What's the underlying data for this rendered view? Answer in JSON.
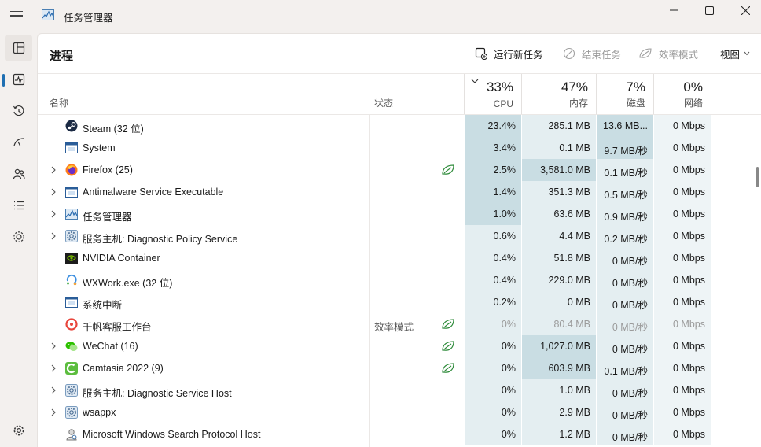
{
  "window": {
    "title": "任务管理器"
  },
  "sidebar": {
    "items": [
      {
        "name": "processes",
        "icon": "processes-icon",
        "active": true
      },
      {
        "name": "performance",
        "icon": "performance-icon"
      },
      {
        "name": "app-history",
        "icon": "history-icon"
      },
      {
        "name": "startup-apps",
        "icon": "startup-icon"
      },
      {
        "name": "users",
        "icon": "users-icon"
      },
      {
        "name": "details",
        "icon": "details-icon"
      },
      {
        "name": "services",
        "icon": "services-icon"
      }
    ],
    "settings_icon": "settings-icon"
  },
  "toolbar": {
    "page_title": "进程",
    "run_new_task": "运行新任务",
    "end_task": "结束任务",
    "efficiency_mode": "效率模式",
    "view": "视图"
  },
  "columns": {
    "name": "名称",
    "status": "状态",
    "cpu": {
      "pct": "33%",
      "label": "CPU"
    },
    "memory": {
      "pct": "47%",
      "label": "内存"
    },
    "disk": {
      "pct": "7%",
      "label": "磁盘"
    },
    "network": {
      "pct": "0%",
      "label": "网络"
    }
  },
  "colors": {
    "accent": "#1f6fb2",
    "heat_strong": "#c9dde3",
    "heat_light": "#e4eef1",
    "heat_faint": "#eef4f6",
    "efficiency_green": "#2e8b3a"
  },
  "processes": [
    {
      "name": "Steam (32 位)",
      "icon": "steam-icon",
      "expandable": false,
      "status": "",
      "leaf": false,
      "cpu": "23.4%",
      "mem": "285.1 MB",
      "disk": "13.6 MB...",
      "net": "0 Mbps",
      "heat": [
        "strong",
        "light",
        "strong",
        "faint"
      ]
    },
    {
      "name": "System",
      "icon": "system-icon",
      "expandable": false,
      "status": "",
      "leaf": false,
      "cpu": "3.4%",
      "mem": "0.1 MB",
      "disk": "9.7 MB/秒",
      "net": "0 Mbps",
      "heat": [
        "strong",
        "light",
        "strong",
        "faint"
      ]
    },
    {
      "name": "Firefox (25)",
      "icon": "firefox-icon",
      "expandable": true,
      "status": "",
      "leaf": true,
      "cpu": "2.5%",
      "mem": "3,581.0 MB",
      "disk": "0.1 MB/秒",
      "net": "0 Mbps",
      "heat": [
        "strong",
        "strong",
        "light",
        "faint"
      ]
    },
    {
      "name": "Antimalware Service Executable",
      "icon": "antimalware-icon",
      "expandable": true,
      "status": "",
      "leaf": false,
      "cpu": "1.4%",
      "mem": "351.3 MB",
      "disk": "0.5 MB/秒",
      "net": "0 Mbps",
      "heat": [
        "strong",
        "light",
        "light",
        "faint"
      ]
    },
    {
      "name": "任务管理器",
      "icon": "taskmgr-icon",
      "expandable": true,
      "status": "",
      "leaf": false,
      "cpu": "1.0%",
      "mem": "63.6 MB",
      "disk": "0.9 MB/秒",
      "net": "0 Mbps",
      "heat": [
        "strong",
        "light",
        "light",
        "faint"
      ]
    },
    {
      "name": "服务主机: Diagnostic Policy Service",
      "icon": "service-host-icon",
      "expandable": true,
      "status": "",
      "leaf": false,
      "cpu": "0.6%",
      "mem": "4.4 MB",
      "disk": "0.2 MB/秒",
      "net": "0 Mbps",
      "heat": [
        "light",
        "light",
        "light",
        "faint"
      ]
    },
    {
      "name": "NVIDIA Container",
      "icon": "nvidia-icon",
      "expandable": false,
      "status": "",
      "leaf": false,
      "cpu": "0.4%",
      "mem": "51.8 MB",
      "disk": "0 MB/秒",
      "net": "0 Mbps",
      "heat": [
        "light",
        "light",
        "light",
        "faint"
      ]
    },
    {
      "name": "WXWork.exe (32 位)",
      "icon": "wxwork-icon",
      "expandable": false,
      "status": "",
      "leaf": false,
      "cpu": "0.4%",
      "mem": "229.0 MB",
      "disk": "0 MB/秒",
      "net": "0 Mbps",
      "heat": [
        "light",
        "light",
        "light",
        "faint"
      ]
    },
    {
      "name": "系统中断",
      "icon": "interrupt-icon",
      "expandable": false,
      "status": "",
      "leaf": false,
      "cpu": "0.2%",
      "mem": "0 MB",
      "disk": "0 MB/秒",
      "net": "0 Mbps",
      "heat": [
        "light",
        "light",
        "light",
        "faint"
      ]
    },
    {
      "name": "千帆客服工作台",
      "icon": "qianfan-icon",
      "expandable": false,
      "status": "效率模式",
      "leaf": true,
      "dim": true,
      "cpu": "0%",
      "mem": "80.4 MB",
      "disk": "0 MB/秒",
      "net": "0 Mbps",
      "heat": [
        "light",
        "light",
        "light",
        "faint"
      ]
    },
    {
      "name": "WeChat (16)",
      "icon": "wechat-icon",
      "expandable": true,
      "status": "",
      "leaf": true,
      "cpu": "0%",
      "mem": "1,027.0 MB",
      "disk": "0 MB/秒",
      "net": "0 Mbps",
      "heat": [
        "light",
        "strong",
        "light",
        "faint"
      ]
    },
    {
      "name": "Camtasia 2022 (9)",
      "icon": "camtasia-icon",
      "expandable": true,
      "status": "",
      "leaf": true,
      "cpu": "0%",
      "mem": "603.9 MB",
      "disk": "0.1 MB/秒",
      "net": "0 Mbps",
      "heat": [
        "light",
        "strong",
        "light",
        "faint"
      ]
    },
    {
      "name": "服务主机: Diagnostic Service Host",
      "icon": "service-host-icon",
      "expandable": true,
      "status": "",
      "leaf": false,
      "cpu": "0%",
      "mem": "1.0 MB",
      "disk": "0 MB/秒",
      "net": "0 Mbps",
      "heat": [
        "light",
        "light",
        "light",
        "faint"
      ]
    },
    {
      "name": "wsappx",
      "icon": "service-host-icon",
      "expandable": true,
      "status": "",
      "leaf": false,
      "cpu": "0%",
      "mem": "2.9 MB",
      "disk": "0 MB/秒",
      "net": "0 Mbps",
      "heat": [
        "light",
        "light",
        "light",
        "faint"
      ]
    },
    {
      "name": "Microsoft Windows Search Protocol Host",
      "icon": "search-host-icon",
      "expandable": false,
      "status": "",
      "leaf": false,
      "cpu": "0%",
      "mem": "1.2 MB",
      "disk": "0 MB/秒",
      "net": "0 Mbps",
      "heat": [
        "light",
        "light",
        "light",
        "faint"
      ]
    }
  ]
}
